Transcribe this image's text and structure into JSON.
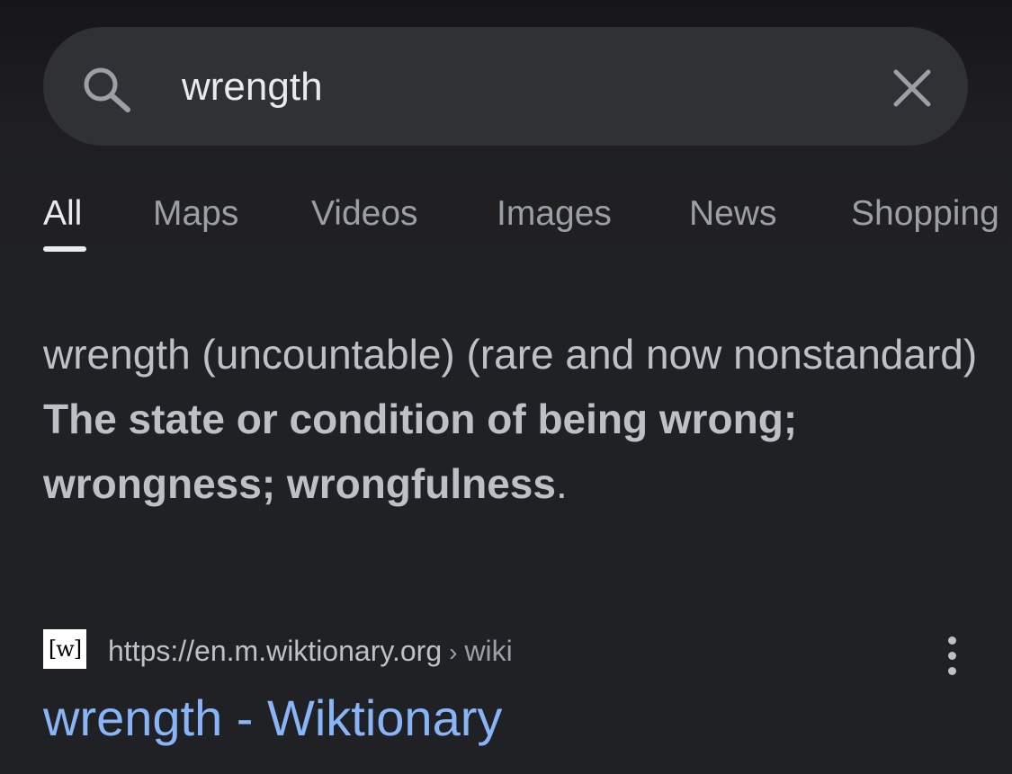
{
  "search": {
    "query": "wrength",
    "search_icon": "search-icon",
    "clear_icon": "close-icon"
  },
  "tabs": [
    {
      "label": "All",
      "active": true
    },
    {
      "label": "Maps",
      "active": false
    },
    {
      "label": "Videos",
      "active": false
    },
    {
      "label": "Images",
      "active": false
    },
    {
      "label": "News",
      "active": false
    },
    {
      "label": "Shopping",
      "active": false
    }
  ],
  "snippet": {
    "part1": "wrength (uncountable) (rare and now nonstandard) ",
    "bold": "The state or condition of being wrong; wrongness; wrongfulness",
    "part2": "."
  },
  "result": {
    "favicon_text": "[w]",
    "url": "https://en.m.wiktionary.org",
    "separator": "›",
    "path": "wiki",
    "title": "wrength - Wiktionary",
    "more_icon": "more-vert-icon"
  },
  "colors": {
    "background": "#202124",
    "search_bar": "#303134",
    "link": "#8ab4f8",
    "text": "#bdc1c6",
    "active_tab": "#e8eaed"
  }
}
